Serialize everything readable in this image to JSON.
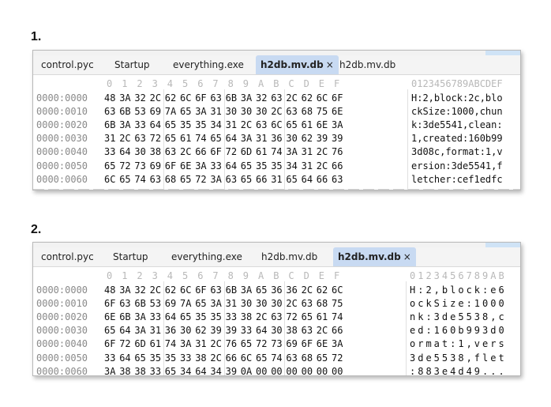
{
  "panels": [
    {
      "label": "1.",
      "tabs": [
        {
          "label": "control.pyc",
          "active": false
        },
        {
          "label": "Startup",
          "active": false
        },
        {
          "label": "everything.exe",
          "active": false
        },
        {
          "label": "h2db.mv.db",
          "active": true,
          "close": "×"
        },
        {
          "label": "h2db.mv.db",
          "active": false
        }
      ],
      "column_header": [
        "0",
        "1",
        "2",
        "3",
        "4",
        "5",
        "6",
        "7",
        "8",
        "9",
        "A",
        "B",
        "C",
        "D",
        "E",
        "F"
      ],
      "ascii_header": "0123456789ABCDEF",
      "rows": [
        {
          "offset": "0000:0000",
          "hex": [
            "48",
            "3A",
            "32",
            "2C",
            "62",
            "6C",
            "6F",
            "63",
            "6B",
            "3A",
            "32",
            "63",
            "2C",
            "62",
            "6C",
            "6F"
          ],
          "ascii": "H:2,block:2c,blo"
        },
        {
          "offset": "0000:0010",
          "hex": [
            "63",
            "6B",
            "53",
            "69",
            "7A",
            "65",
            "3A",
            "31",
            "30",
            "30",
            "30",
            "2C",
            "63",
            "68",
            "75",
            "6E"
          ],
          "ascii": "ckSize:1000,chun"
        },
        {
          "offset": "0000:0020",
          "hex": [
            "6B",
            "3A",
            "33",
            "64",
            "65",
            "35",
            "35",
            "34",
            "31",
            "2C",
            "63",
            "6C",
            "65",
            "61",
            "6E",
            "3A"
          ],
          "ascii": "k:3de5541,clean:"
        },
        {
          "offset": "0000:0030",
          "hex": [
            "31",
            "2C",
            "63",
            "72",
            "65",
            "61",
            "74",
            "65",
            "64",
            "3A",
            "31",
            "36",
            "30",
            "62",
            "39",
            "39"
          ],
          "ascii": "1,created:160b99"
        },
        {
          "offset": "0000:0040",
          "hex": [
            "33",
            "64",
            "30",
            "38",
            "63",
            "2C",
            "66",
            "6F",
            "72",
            "6D",
            "61",
            "74",
            "3A",
            "31",
            "2C",
            "76"
          ],
          "ascii": "3d08c,format:1,v"
        },
        {
          "offset": "0000:0050",
          "hex": [
            "65",
            "72",
            "73",
            "69",
            "6F",
            "6E",
            "3A",
            "33",
            "64",
            "65",
            "35",
            "35",
            "34",
            "31",
            "2C",
            "66"
          ],
          "ascii": "ersion:3de5541,f"
        },
        {
          "offset": "0000:0060",
          "hex": [
            "6C",
            "65",
            "74",
            "63",
            "68",
            "65",
            "72",
            "3A",
            "63",
            "65",
            "66",
            "31",
            "65",
            "64",
            "66",
            "63"
          ],
          "ascii": "letcher:cef1edfc"
        }
      ]
    },
    {
      "label": "2.",
      "tabs": [
        {
          "label": "control.pyc",
          "active": false
        },
        {
          "label": "Startup",
          "active": false
        },
        {
          "label": "everything.exe",
          "active": false
        },
        {
          "label": "h2db.mv.db",
          "active": false
        },
        {
          "label": "h2db.mv.db",
          "active": true,
          "close": "×"
        }
      ],
      "column_header": [
        "0",
        "1",
        "2",
        "3",
        "4",
        "5",
        "6",
        "7",
        "8",
        "9",
        "A",
        "B",
        "C",
        "D",
        "E",
        "F"
      ],
      "ascii_header": "0123456789AB",
      "rows": [
        {
          "offset": "0000:0000",
          "hex": [
            "48",
            "3A",
            "32",
            "2C",
            "62",
            "6C",
            "6F",
            "63",
            "6B",
            "3A",
            "65",
            "36",
            "36",
            "2C",
            "62",
            "6C"
          ],
          "ascii": "H:2,block:e6"
        },
        {
          "offset": "0000:0010",
          "hex": [
            "6F",
            "63",
            "6B",
            "53",
            "69",
            "7A",
            "65",
            "3A",
            "31",
            "30",
            "30",
            "30",
            "2C",
            "63",
            "68",
            "75"
          ],
          "ascii": "ockSize:1000"
        },
        {
          "offset": "0000:0020",
          "hex": [
            "6E",
            "6B",
            "3A",
            "33",
            "64",
            "65",
            "35",
            "35",
            "33",
            "38",
            "2C",
            "63",
            "72",
            "65",
            "61",
            "74"
          ],
          "ascii": "nk:3de5538,c"
        },
        {
          "offset": "0000:0030",
          "hex": [
            "65",
            "64",
            "3A",
            "31",
            "36",
            "30",
            "62",
            "39",
            "39",
            "33",
            "64",
            "30",
            "38",
            "63",
            "2C",
            "66"
          ],
          "ascii": "ed:160b993d0"
        },
        {
          "offset": "0000:0040",
          "hex": [
            "6F",
            "72",
            "6D",
            "61",
            "74",
            "3A",
            "31",
            "2C",
            "76",
            "65",
            "72",
            "73",
            "69",
            "6F",
            "6E",
            "3A"
          ],
          "ascii": "ormat:1,vers"
        },
        {
          "offset": "0000:0050",
          "hex": [
            "33",
            "64",
            "65",
            "35",
            "35",
            "33",
            "38",
            "2C",
            "66",
            "6C",
            "65",
            "74",
            "63",
            "68",
            "65",
            "72"
          ],
          "ascii": "3de5538,flet"
        },
        {
          "offset": "0000:0060",
          "hex": [
            "3A",
            "38",
            "38",
            "33",
            "65",
            "34",
            "64",
            "34",
            "39",
            "0A",
            "00",
            "00",
            "00",
            "00",
            "00",
            "00"
          ],
          "ascii": ":883e4d49..."
        }
      ]
    }
  ]
}
